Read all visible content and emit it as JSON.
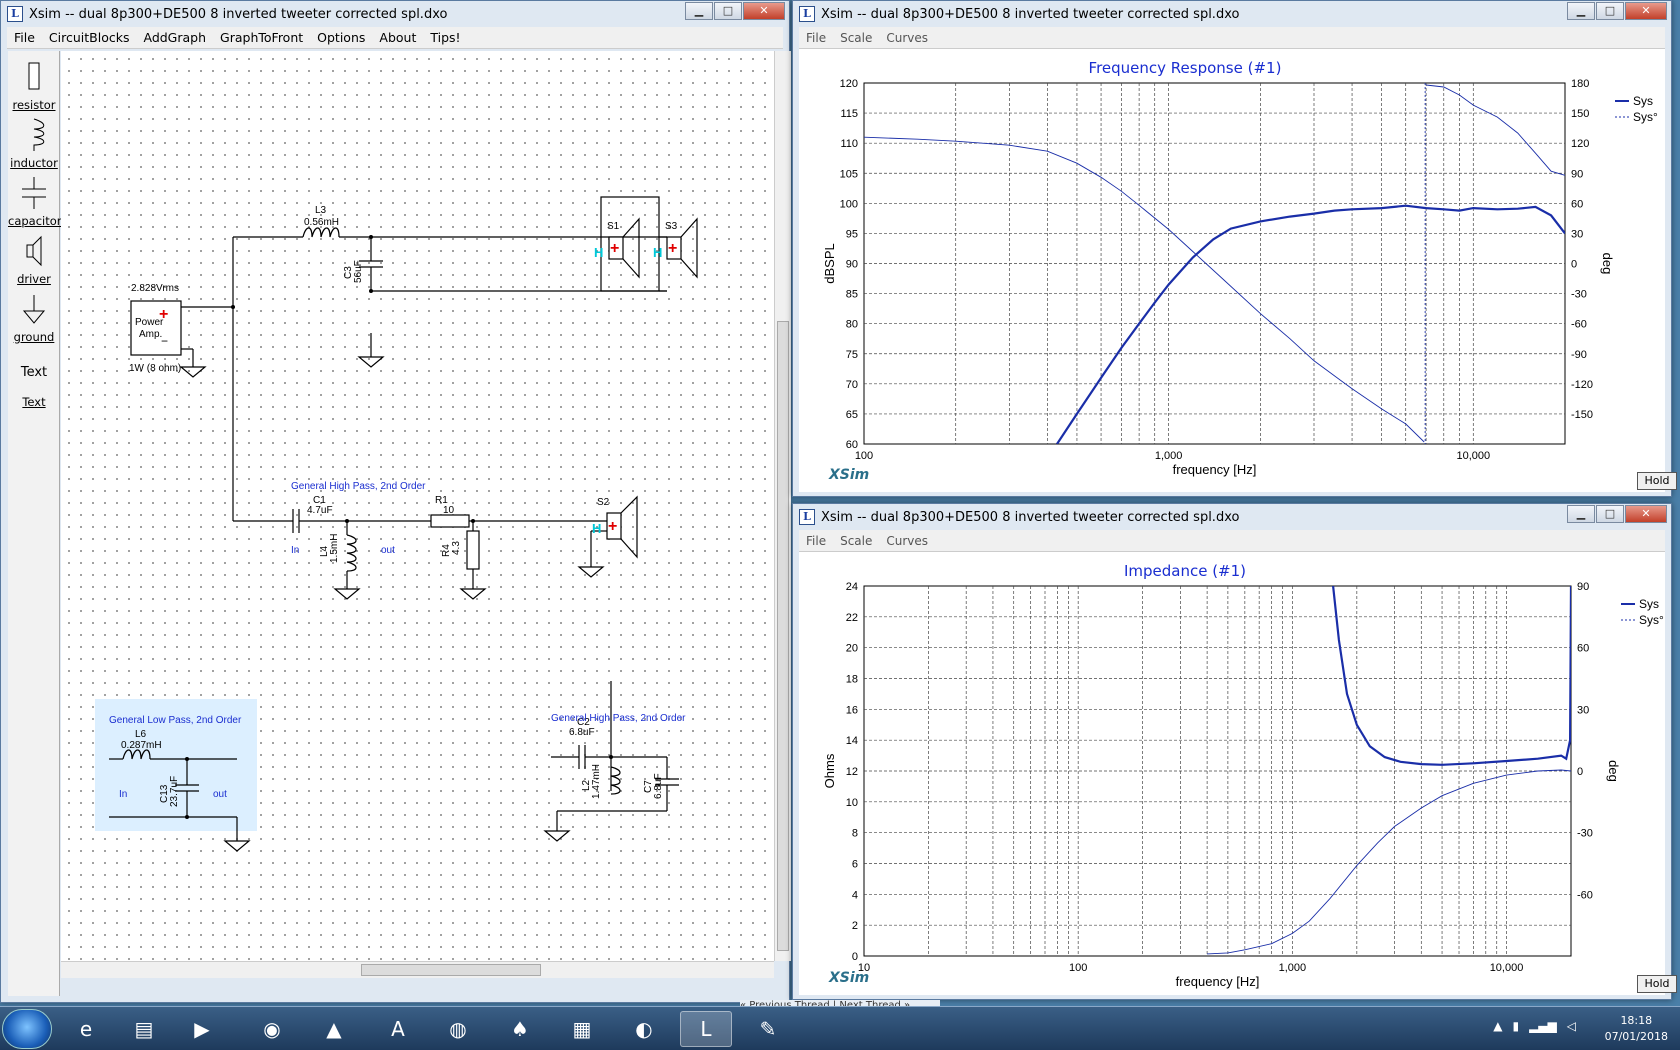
{
  "windows": {
    "editor": {
      "title": "Xsim -- dual 8p300+DE500 8 inverted tweeter corrected spl.dxo",
      "menu": [
        "File",
        "CircuitBlocks",
        "AddGraph",
        "GraphToFront",
        "Options",
        "About",
        "Tips!"
      ]
    },
    "freq": {
      "title": "Xsim -- dual 8p300+DE500 8 inverted tweeter corrected spl.dxo",
      "menu": [
        "File",
        "Scale",
        "Curves"
      ],
      "plot_title": "Frequency Response (#1)",
      "hold": "Hold",
      "logo": "XSim"
    },
    "imp": {
      "title": "Xsim -- dual 8p300+DE500 8 inverted tweeter corrected spl.dxo",
      "menu": [
        "File",
        "Scale",
        "Curves"
      ],
      "plot_title": "Impedance (#1)",
      "hold": "Hold",
      "logo": "XSim"
    }
  },
  "palette": [
    {
      "label": "resistor",
      "icon": "resistor-icon"
    },
    {
      "label": "inductor",
      "icon": "inductor-icon"
    },
    {
      "label": "capacitor",
      "icon": "capacitor-icon"
    },
    {
      "label": "driver",
      "icon": "driver-icon"
    },
    {
      "label": "ground",
      "icon": "ground-icon"
    },
    {
      "label": "Text",
      "icon": "text-icon"
    },
    {
      "label": "Text",
      "icon": "text-link"
    }
  ],
  "circuit": {
    "source_voltage": "2.828Vrms",
    "source_name_1": "Power",
    "source_name_2": "Amp.",
    "source_power": "1W (8 ohm)",
    "L3_name": "L3",
    "L3_val": "0.56mH",
    "C3_name": "C3",
    "C3_val": "56uF",
    "S1": "S1",
    "S3": "S3",
    "S2": "S2",
    "hp1_title": "General High Pass, 2nd Order",
    "C1_name": "C1",
    "C1_val": "4.7uF",
    "L4_name": "L4",
    "L4_val": "1.5mH",
    "R1_name": "R1",
    "R1_val": "10",
    "R4_name": "R4",
    "R4_val": "4.3",
    "in_label": "In",
    "out_label": "out",
    "lp_title": "General Low Pass, 2nd Order",
    "L6_name": "L6",
    "L6_val": "0.287mH",
    "C13_name": "C13",
    "C13_val": "23.7uF",
    "hp2_title": "General High Pass, 2nd Order",
    "C2_name": "C2",
    "C2_val": "6.8uF",
    "L2_name": "L2",
    "L2_val": "1.47mH",
    "C7_name": "C7",
    "C7_val": "6.8uF",
    "plus": "+",
    "minus": "−",
    "h": "H"
  },
  "chart_data": [
    {
      "type": "line",
      "title": "Frequency Response (#1)",
      "xlabel": "frequency [Hz]",
      "ylabel": "dBSPL",
      "y2label": "deg",
      "xscale": "log",
      "xlim": [
        100,
        20000
      ],
      "ylim": [
        60,
        120
      ],
      "y2lim": [
        -180,
        180
      ],
      "x_ticks": [
        "100",
        "1,000",
        "10,000"
      ],
      "y_ticks": [
        60,
        65,
        70,
        75,
        80,
        85,
        90,
        95,
        100,
        105,
        110,
        115,
        120
      ],
      "y2_ticks": [
        -150,
        -120,
        -90,
        -60,
        -30,
        0,
        30,
        60,
        90,
        120,
        150,
        180
      ],
      "legend": [
        "Sys",
        "Sys°"
      ],
      "legend_position": "right",
      "grid": true,
      "series": [
        {
          "name": "Sys",
          "axis": "y",
          "x": [
            430,
            500,
            600,
            700,
            800,
            900,
            1000,
            1200,
            1400,
            1600,
            2000,
            2500,
            3000,
            3500,
            4000,
            5000,
            6000,
            7000,
            8000,
            9000,
            10000,
            12000,
            14000,
            16000,
            18000,
            20000
          ],
          "y": [
            60,
            65,
            71,
            76,
            80,
            83.5,
            86.5,
            91,
            94,
            95.8,
            97,
            97.8,
            98.3,
            98.8,
            99,
            99.2,
            99.6,
            99.2,
            99,
            98.8,
            99.2,
            99,
            99.1,
            99.4,
            98,
            95
          ]
        },
        {
          "name": "Sys°",
          "axis": "y2",
          "x": [
            100,
            150,
            200,
            300,
            400,
            500,
            600,
            700,
            800,
            1000,
            1200,
            1500,
            2000,
            2500,
            3000,
            4000,
            5000,
            6000,
            6900,
            7000,
            8000,
            9000,
            10000,
            12000,
            14000,
            16000,
            18000,
            20000
          ],
          "y": [
            126,
            124,
            122,
            118,
            112,
            100,
            86,
            72,
            58,
            34,
            12,
            -15,
            -50,
            -75,
            -97,
            -125,
            -145,
            -160,
            -178,
            178,
            176,
            168,
            158,
            146,
            130,
            110,
            92,
            88
          ]
        }
      ]
    },
    {
      "type": "line",
      "title": "Impedance (#1)",
      "xlabel": "frequency [Hz]",
      "ylabel": "Ohms",
      "y2label": "deg",
      "xscale": "log",
      "xlim": [
        10,
        20000
      ],
      "ylim": [
        0,
        24
      ],
      "y2lim": [
        -90,
        90
      ],
      "x_ticks": [
        "10",
        "100",
        "1,000",
        "10,000"
      ],
      "y_ticks": [
        0,
        2,
        4,
        6,
        8,
        10,
        12,
        14,
        16,
        18,
        20,
        22,
        24
      ],
      "y2_ticks": [
        -60,
        -30,
        0,
        30,
        60,
        90
      ],
      "legend": [
        "Sys",
        "Sys°"
      ],
      "legend_position": "right",
      "grid": true,
      "series": [
        {
          "name": "Sys",
          "axis": "y",
          "x": [
            1550,
            1650,
            1800,
            2000,
            2300,
            2700,
            3200,
            4000,
            5000,
            7000,
            10000,
            14000,
            18000,
            19000,
            19800,
            20000
          ],
          "y": [
            24,
            20.5,
            17,
            15,
            13.6,
            12.9,
            12.6,
            12.45,
            12.4,
            12.5,
            12.65,
            12.8,
            13,
            12.8,
            14,
            24
          ]
        },
        {
          "name": "Sys°",
          "axis": "y2",
          "x": [
            400,
            500,
            600,
            800,
            1000,
            1200,
            1500,
            2000,
            2500,
            3000,
            4000,
            5000,
            7000,
            10000,
            14000,
            18000,
            20000
          ],
          "y": [
            -89,
            -88.5,
            -87,
            -84,
            -79,
            -73,
            -62,
            -46,
            -35,
            -27,
            -18,
            -12,
            -6,
            -2,
            0,
            0.5,
            0
          ]
        }
      ]
    }
  ],
  "taskbar": {
    "icons": [
      "ie-icon",
      "folder-icon",
      "media-icon",
      "chrome-icon",
      "vlc-icon",
      "autocad-icon",
      "firefox-icon",
      "acrobat-icon",
      "winrar-icon",
      "speaker-icon",
      "xsim-icon",
      "paint-icon"
    ],
    "time": "18:18",
    "date": "07/01/2018"
  },
  "forum_links": "« Previous Thread | Next Thread »"
}
